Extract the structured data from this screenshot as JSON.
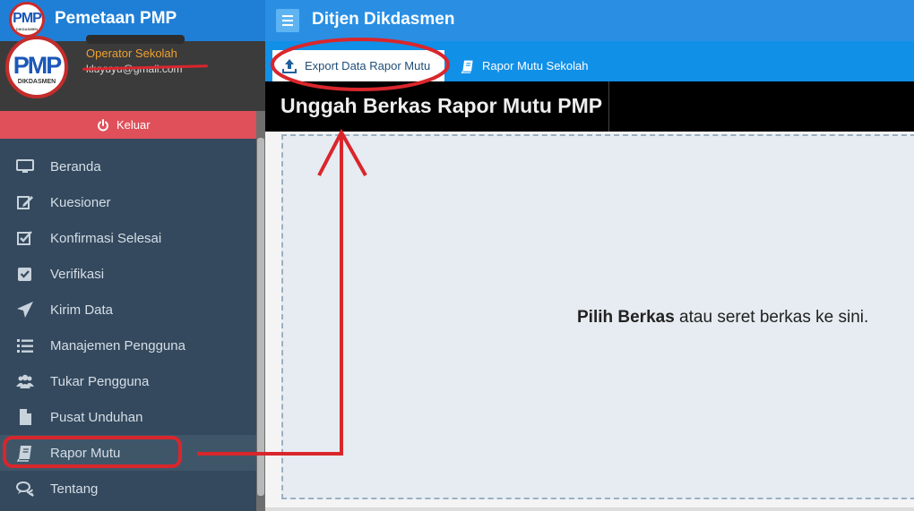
{
  "app": {
    "title": "Pemetaan PMP",
    "logo_text": "PMP",
    "logo_subtext": "DIKDASMEN",
    "page_title": "Ditjen Dikdasmen"
  },
  "profile": {
    "role": "Operator Sekolah",
    "email": "kluyuyu@gmail.com"
  },
  "logout": {
    "label": "Keluar"
  },
  "sidebar": {
    "items": [
      {
        "label": "Beranda",
        "icon": "monitor-icon"
      },
      {
        "label": "Kuesioner",
        "icon": "edit-icon"
      },
      {
        "label": "Konfirmasi Selesai",
        "icon": "checkbox-icon"
      },
      {
        "label": "Verifikasi",
        "icon": "check-square-icon"
      },
      {
        "label": "Kirim Data",
        "icon": "paper-plane-icon"
      },
      {
        "label": "Manajemen Pengguna",
        "icon": "list-icon"
      },
      {
        "label": "Tukar Pengguna",
        "icon": "users-icon"
      },
      {
        "label": "Pusat Unduhan",
        "icon": "file-icon"
      },
      {
        "label": "Rapor Mutu",
        "icon": "book-icon",
        "active": true
      },
      {
        "label": "Tentang",
        "icon": "comments-icon"
      }
    ]
  },
  "tabs": [
    {
      "label": "Export Data Rapor Mutu",
      "icon": "upload-icon",
      "active": true
    },
    {
      "label": "Rapor Mutu Sekolah",
      "icon": "book-icon",
      "active": false
    }
  ],
  "panel": {
    "title": "Unggah Berkas Rapor Mutu PMP",
    "dropzone_bold": "Pilih Berkas",
    "dropzone_rest": " atau seret berkas ke sini."
  },
  "colors": {
    "topbar": "#2a8fe3",
    "sidebar": "#34495e",
    "logout": "#e0505a",
    "annotation": "#d9262c",
    "role_text": "#f0a030"
  }
}
